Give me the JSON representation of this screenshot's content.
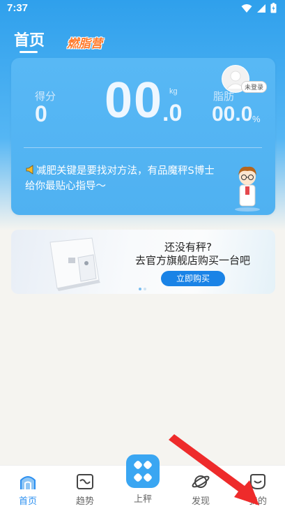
{
  "status_bar": {
    "time": "7:37"
  },
  "header": {
    "tab_home": "首页",
    "tab_fat_camp": "燃脂营"
  },
  "card": {
    "score_label": "得分",
    "score_value": "0",
    "weight_int": "00",
    "weight_unit": "kg",
    "weight_dec": ".0",
    "fat_label": "脂肪",
    "fat_value": "00.0",
    "fat_unit": "%",
    "login_badge": "未登录",
    "tip": "减肥关键是要找对方法，有品魔秤S博士给你最贴心指导～"
  },
  "banner": {
    "line1": "还没有秤?",
    "line2": "去官方旗舰店购买一台吧",
    "buy_button": "立即购买"
  },
  "bottom_nav": {
    "items": [
      {
        "label": "首页",
        "icon": "home-icon",
        "active": true
      },
      {
        "label": "趋势",
        "icon": "trend-icon",
        "active": false
      },
      {
        "label": "上秤",
        "icon": "scale-weigh-icon",
        "active": false
      },
      {
        "label": "发现",
        "icon": "planet-icon",
        "active": false
      },
      {
        "label": "我的",
        "icon": "profile-smile-icon",
        "active": false
      }
    ]
  },
  "colors": {
    "primary_blue": "#2b8ff0",
    "header_bg": "#2fa0ec",
    "card_bg": "#58b8f5",
    "accent_orange": "#ff7a2c",
    "annotation_red": "#ee2b2b"
  }
}
